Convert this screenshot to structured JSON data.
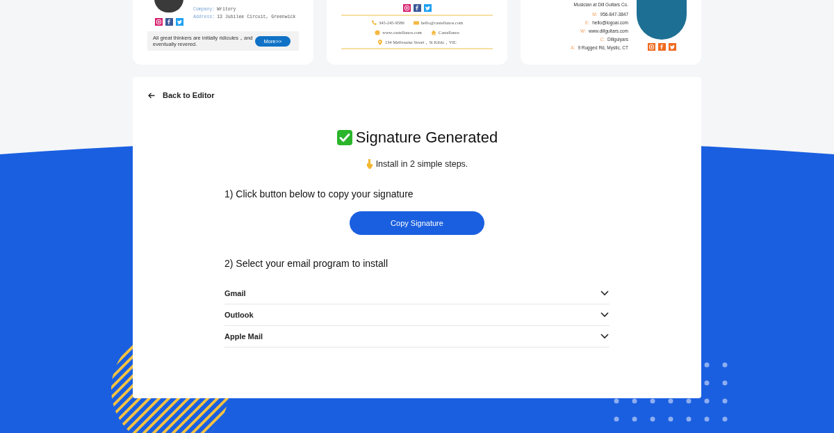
{
  "cards": [
    {
      "kind": "profile",
      "details": [
        {
          "label": "Company:",
          "value": "Writory"
        },
        {
          "label": "Address:",
          "value": "13 Jubilee Circuit, Greenwick"
        }
      ],
      "quote": "All great thinkers are initially ridicules，and eventually revered.",
      "button": "More>>"
    },
    {
      "kind": "centered",
      "contacts": [
        {
          "text": "345-245-9586"
        },
        {
          "text": "hello@castellanos.com"
        },
        {
          "text": "www.castellanos.com"
        },
        {
          "text": "Castellanos"
        },
        {
          "text": "134 Melbourne Street，St Kilda，VIC"
        }
      ]
    },
    {
      "kind": "right",
      "title": "Musician at Dill Guitars Co.",
      "details": [
        {
          "label": "M:",
          "value": "956-847-3847"
        },
        {
          "label": "E:",
          "value": "hello@logoai.com"
        },
        {
          "label": "W:",
          "value": "www.dillguitars.com"
        },
        {
          "label": "C:",
          "value": "Dillguiyars"
        },
        {
          "label": "A:",
          "value": "9 Rugged Rd,  Mystic, CT"
        }
      ]
    }
  ],
  "back_link": "Back to Editor",
  "heading": "Signature Generated",
  "subheading": "Install in 2 simple steps.",
  "step_1": {
    "title": "1) Click button below to copy your signature",
    "button": "Copy Signature"
  },
  "step_2": {
    "title": "2) Select your email program to install",
    "programs": [
      {
        "label": "Gmail",
        "expanded": false
      },
      {
        "label": "Outlook",
        "expanded": false
      },
      {
        "label": "Apple Mail",
        "expanded": false
      }
    ]
  }
}
